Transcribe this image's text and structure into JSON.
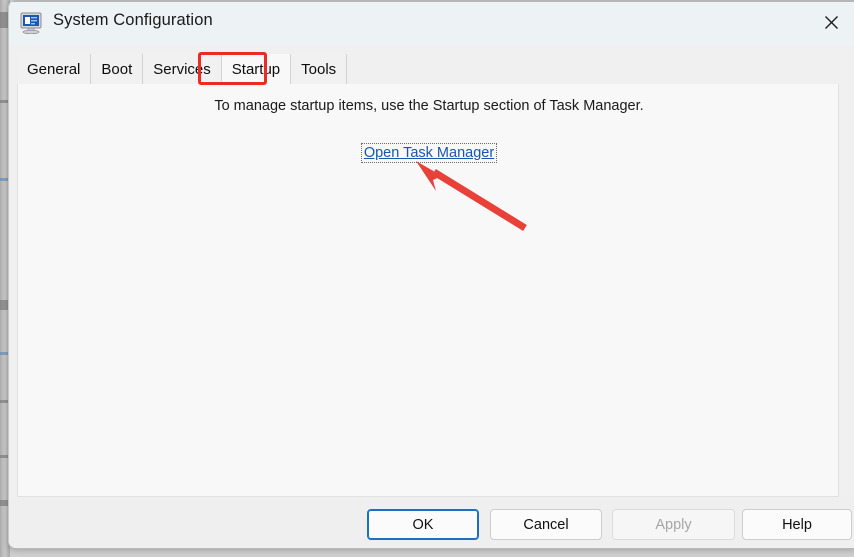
{
  "window": {
    "title": "System Configuration",
    "app_icon": "computer-monitor-icon",
    "close_label": "✕"
  },
  "tabs": [
    {
      "label": "General",
      "selected": false
    },
    {
      "label": "Boot",
      "selected": false
    },
    {
      "label": "Services",
      "selected": false
    },
    {
      "label": "Startup",
      "selected": true
    },
    {
      "label": "Tools",
      "selected": false
    }
  ],
  "content": {
    "info_text": "To manage startup items, use the Startup section of Task Manager.",
    "link_label": "Open Task Manager"
  },
  "footer": {
    "ok_label": "OK",
    "cancel_label": "Cancel",
    "apply_label": "Apply",
    "help_label": "Help",
    "apply_enabled": false
  },
  "annotations": {
    "highlight_color": "#ee2b22",
    "arrow_color": "#e8413a",
    "highlight_target": "Startup",
    "arrow_target": "Open Task Manager"
  },
  "colors": {
    "titlebar_bg": "#edf3f5",
    "dialog_bg": "#f0f0f0",
    "panel_bg": "#f8f8f8",
    "link": "#1756b0",
    "focus_border": "#1f6fbd"
  }
}
